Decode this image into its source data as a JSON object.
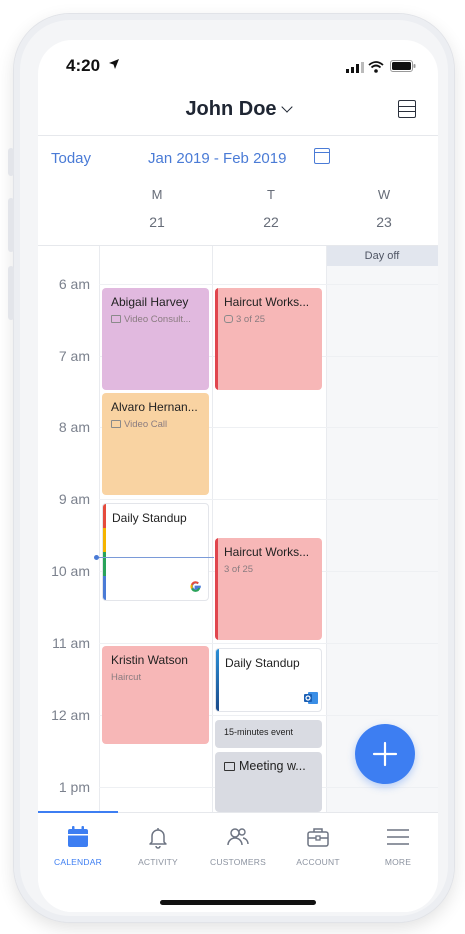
{
  "status": {
    "time": "4:20"
  },
  "header": {
    "user_name": "John Doe"
  },
  "toolbar": {
    "today_label": "Today",
    "date_range": "Jan 2019 - Feb 2019"
  },
  "days": [
    {
      "name": "M",
      "number": "21"
    },
    {
      "name": "T",
      "number": "22"
    },
    {
      "name": "W",
      "number": "23"
    }
  ],
  "hours": [
    "6 am",
    "7 am",
    "8 am",
    "9 am",
    "10 am",
    "11 am",
    "12 am",
    "1 pm"
  ],
  "day_off_label": "Day off",
  "events": {
    "abigail": {
      "title": "Abigail Harvey",
      "sub": "Video Consult..."
    },
    "alvaro": {
      "title": "Alvaro Hernan...",
      "sub": "Video Call"
    },
    "standup_mon": {
      "title": "Daily Standup"
    },
    "kristin": {
      "title": "Kristin Watson",
      "sub": "Haircut"
    },
    "haircut1": {
      "title": "Haircut Works...",
      "sub": "3 of 25"
    },
    "haircut2": {
      "title": "Haircut Works...",
      "sub": "3 of 25"
    },
    "standup_tue": {
      "title": "Daily Standup"
    },
    "fifteen": {
      "title": "15-minutes event"
    },
    "meeting": {
      "title": "Meeting w..."
    }
  },
  "colors": {
    "accent": "#3d7ef2",
    "purple": "#e1b9df",
    "orange": "#f9d3a2",
    "pink": "#f7b7b7",
    "red": "#e0464e",
    "gray_event": "#d9dbe2"
  },
  "tabs": [
    {
      "label": "CALENDAR",
      "icon": "calendar-icon",
      "active": true
    },
    {
      "label": "ACTIVITY",
      "icon": "bell-icon",
      "active": false
    },
    {
      "label": "CUSTOMERS",
      "icon": "customers-icon",
      "active": false
    },
    {
      "label": "ACCOUNT",
      "icon": "briefcase-icon",
      "active": false
    },
    {
      "label": "MORE",
      "icon": "menu-icon",
      "active": false
    }
  ]
}
